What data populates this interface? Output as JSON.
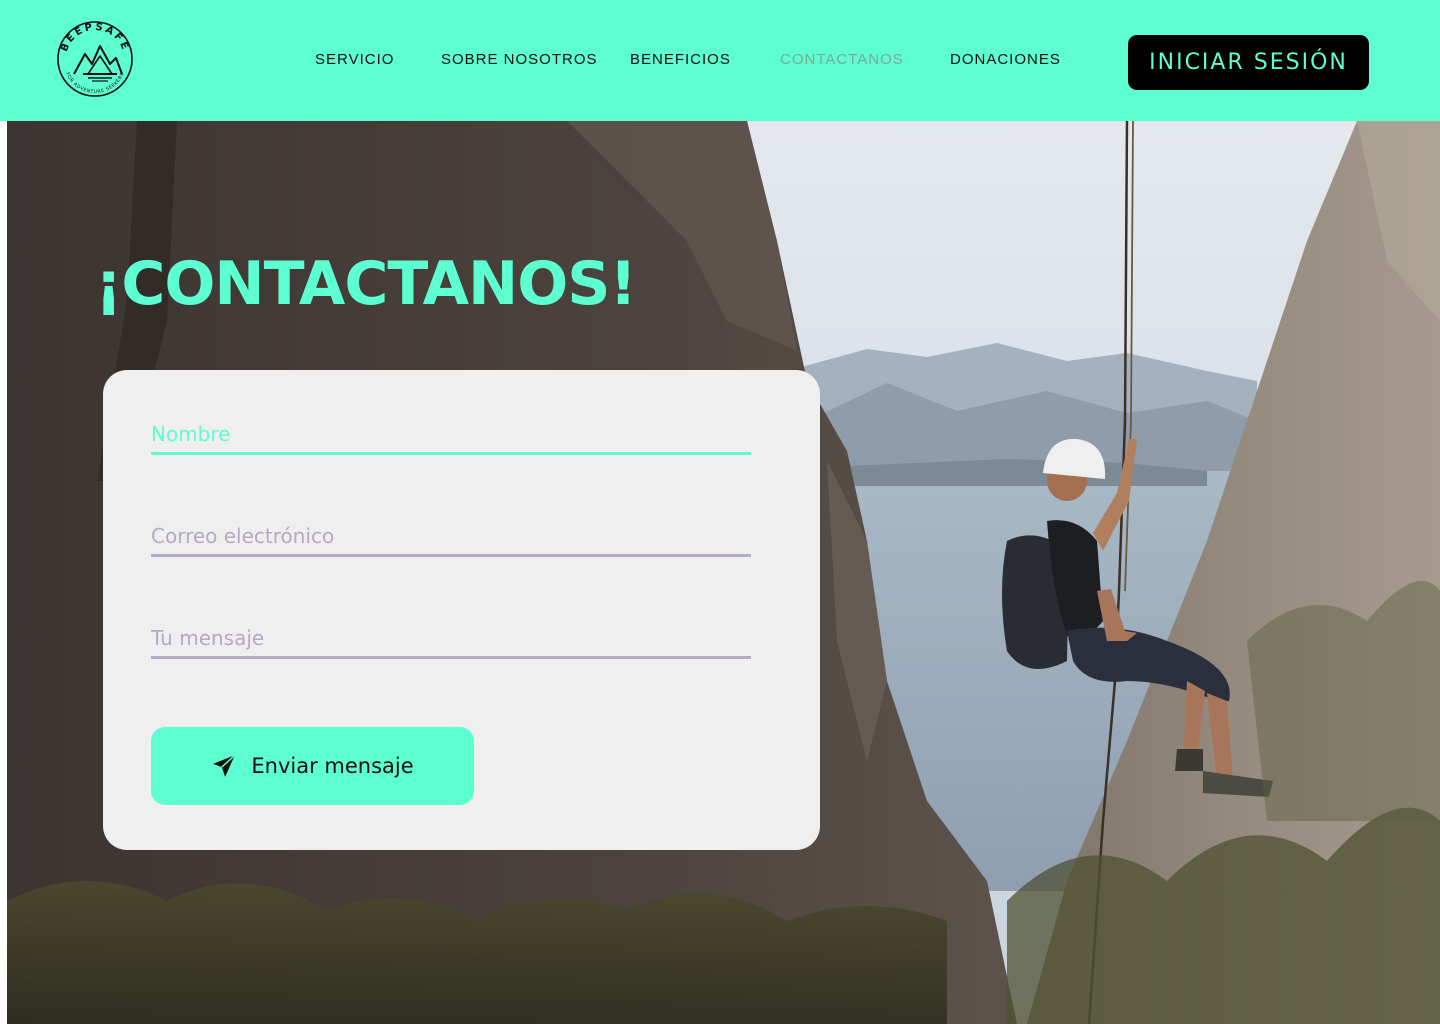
{
  "brand": {
    "name": "BEEPSAFE",
    "tagline": "FOR ADVENTURE SEEKERS"
  },
  "nav": {
    "items": [
      {
        "label": "SERVICIO"
      },
      {
        "label": "SOBRE NOSOTROS"
      },
      {
        "label": "BENEFICIOS"
      },
      {
        "label": "CONTACTANOS",
        "active": true
      },
      {
        "label": "DONACIONES"
      }
    ],
    "login_label": "INICIAR SESIÓN"
  },
  "main": {
    "title": "¡CONTACTANOS!"
  },
  "form": {
    "name_placeholder": "Nombre",
    "email_placeholder": "Correo electrónico",
    "message_placeholder": "Tu mensaje",
    "submit_label": "Enviar mensaje",
    "submit_icon": "paper-plane-icon"
  },
  "colors": {
    "accent": "#5dfecf",
    "dark": "#000000",
    "card_bg": "#efefef",
    "placeholder": "#b6a9c4",
    "nav_active": "#7aa89a"
  }
}
